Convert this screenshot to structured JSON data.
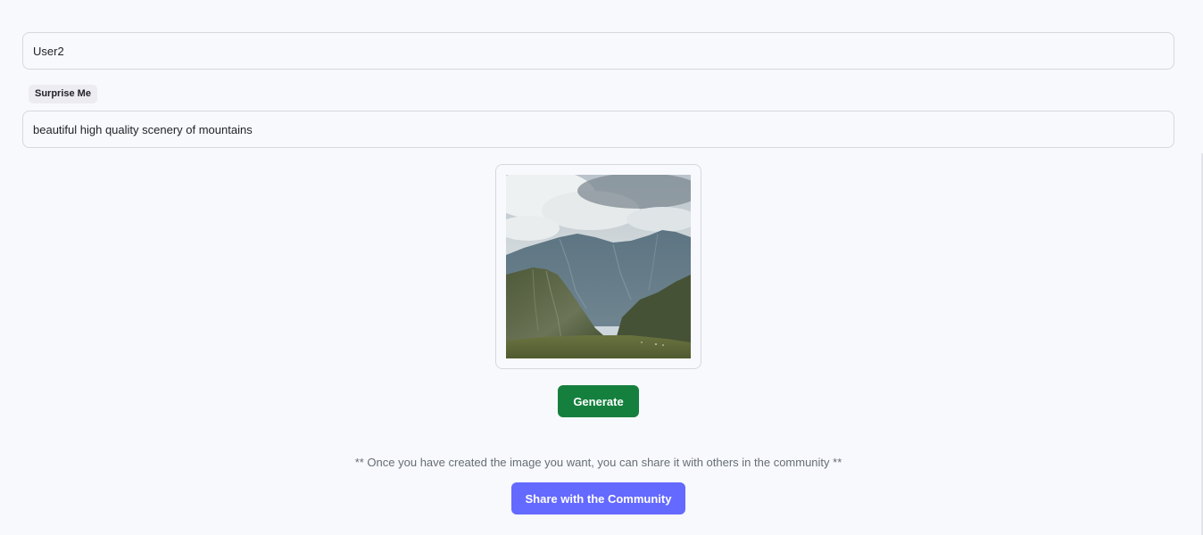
{
  "form": {
    "name_value": "User2",
    "prompt_value": "beautiful high quality scenery of mountains",
    "surprise_label": "Surprise Me"
  },
  "preview": {
    "alt": "beautiful high quality scenery of mountains"
  },
  "actions": {
    "generate_label": "Generate",
    "share_note": "** Once you have created the image you want, you can share it with others in the community **",
    "share_label": "Share with the Community"
  },
  "colors": {
    "background": "#f8f9fd",
    "generate_button": "#15803d",
    "share_button": "#6469ff",
    "surprise_chip": "#ececf1"
  }
}
